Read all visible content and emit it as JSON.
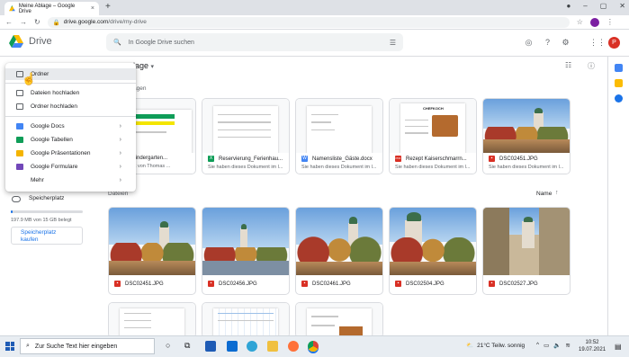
{
  "browser": {
    "tab_title": "Meine Ablage – Google Drive",
    "tab_close": "×",
    "new_tab": "+",
    "url_host": "drive.google.com",
    "url_path": "/drive/my-drive"
  },
  "drive": {
    "app_name": "Drive",
    "search_placeholder": "In Google Drive suchen",
    "avatar_letter": "P",
    "breadcrumb": "Meine Ablage",
    "breadcrumb_visible": "lage",
    "suggested_label": "Vorgeschlagen",
    "suggested_label_visible": "agen",
    "files_label": "Dateien",
    "sort_label": "Name"
  },
  "menu": {
    "items": [
      {
        "label": "Ordner"
      },
      {
        "label": "Dateien hochladen"
      },
      {
        "label": "Ordner hochladen"
      },
      {
        "label": "Google Docs",
        "color": "#4285f4"
      },
      {
        "label": "Google Tabellen",
        "color": "#0f9d58"
      },
      {
        "label": "Google Präsentationen",
        "color": "#f4b400"
      },
      {
        "label": "Google Formulare",
        "color": "#7248b9"
      },
      {
        "label": "Mehr"
      }
    ],
    "chevron": "›"
  },
  "storage": {
    "label": "Speicherplatz",
    "usage": "197.9 MB von 15 GB belegt",
    "usage_fraction": 0.013,
    "buy_line1": "Speicherplatz",
    "buy_line2": "kaufen"
  },
  "suggested": [
    {
      "name": "o-Liste Kindergarten...",
      "sub": "bearbeitet von Thomas ...",
      "type": "sheet"
    },
    {
      "name": "Reservierung_Ferienhau...",
      "sub": "Sie haben dieses Dokument im l...",
      "type": "sheet",
      "icon": "X",
      "color": "#0f9d58"
    },
    {
      "name": "Namensliste_Gäste.docx",
      "sub": "Sie haben dieses Dokument im l...",
      "type": "doc",
      "icon": "W",
      "color": "#4285f4"
    },
    {
      "name": "Rezept Kaiserschmarrn...",
      "sub": "Sie haben dieses Dokument im l...",
      "type": "pdf",
      "icon": "PDF",
      "color": "#d93025"
    },
    {
      "name": "DSC02451.JPG",
      "sub": "Sie haben dieses Dokument im l...",
      "type": "image",
      "icon": "▪",
      "color": "#d93025"
    }
  ],
  "files": [
    {
      "name": "DSC02451.JPG",
      "icon": "▪",
      "color": "#d93025"
    },
    {
      "name": "DSC02456.JPG",
      "icon": "▪",
      "color": "#d93025"
    },
    {
      "name": "DSC02461.JPG",
      "icon": "▪",
      "color": "#d93025"
    },
    {
      "name": "DSC02504.JPG",
      "icon": "▪",
      "color": "#d93025"
    },
    {
      "name": "DSC02527.JPG",
      "icon": "▪",
      "color": "#d93025"
    }
  ],
  "doc_preview": {
    "title": "CHEFKOCH"
  },
  "taskbar": {
    "search_placeholder": "Zur Suche Text hier eingeben",
    "weather": "21°C Teilw. sonnig",
    "time": "10:52",
    "date": "19.07.2021"
  }
}
